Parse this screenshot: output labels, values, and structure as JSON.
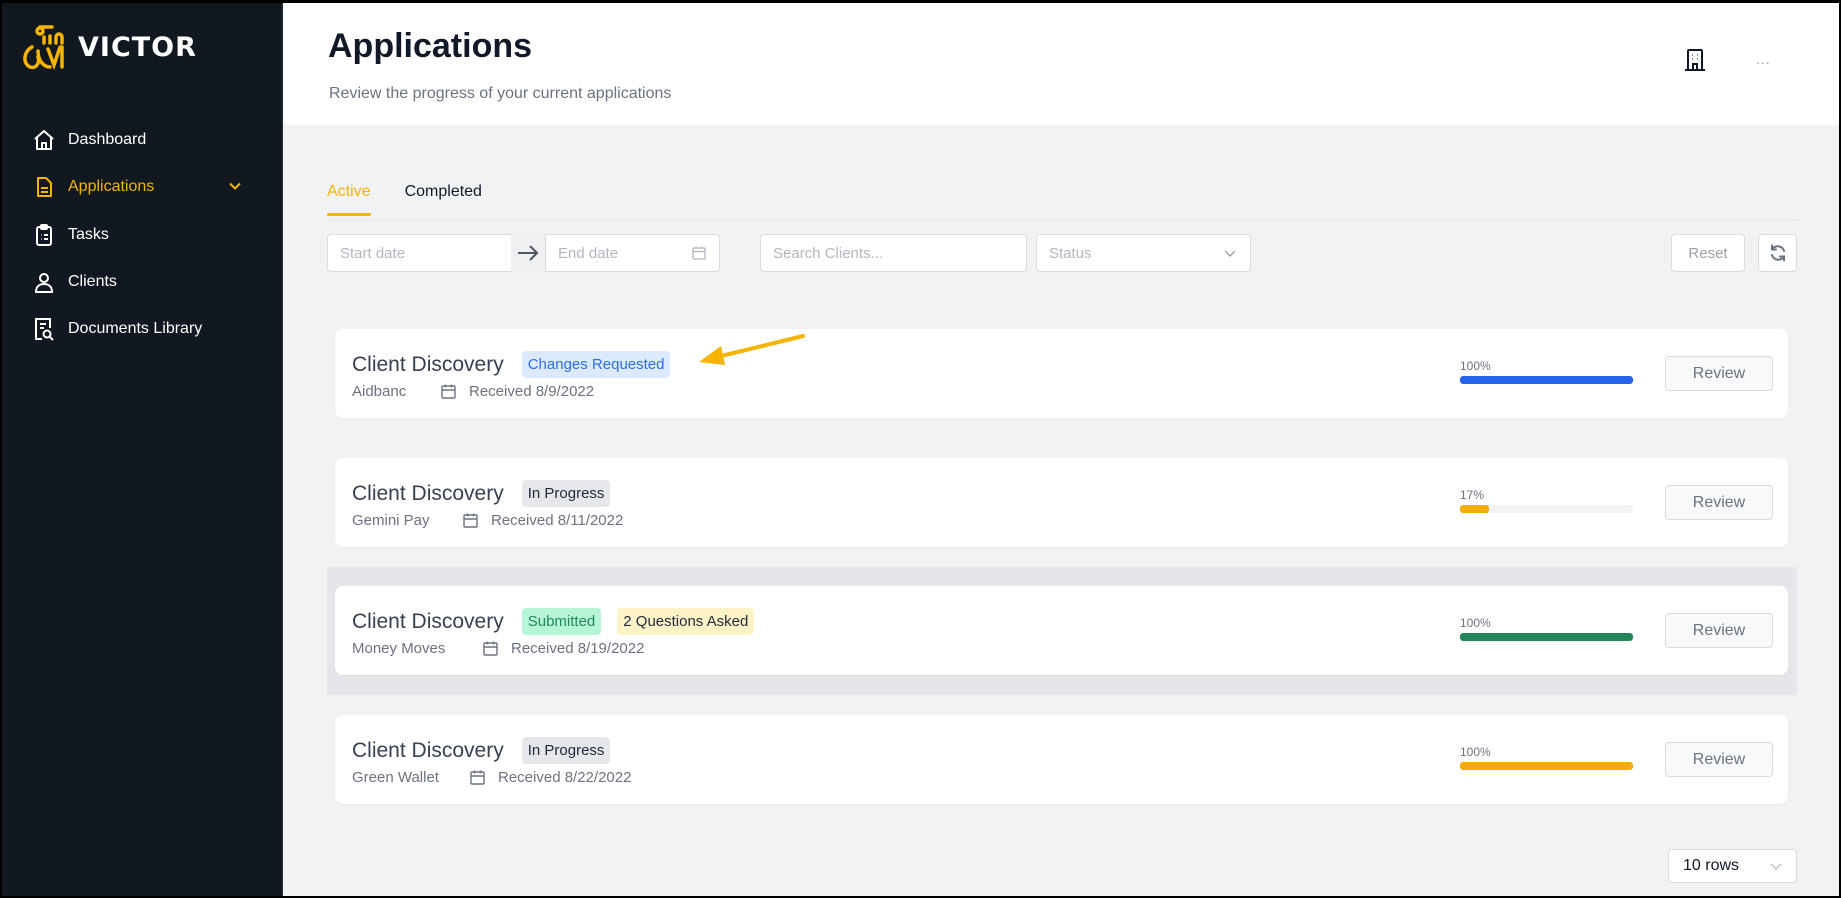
{
  "app": {
    "name": "VICTOR",
    "brand_color": "#f5b400"
  },
  "sidebar": {
    "items": [
      {
        "label": "Dashboard",
        "icon": "home-icon",
        "active": false
      },
      {
        "label": "Applications",
        "icon": "document-icon",
        "active": true,
        "expandable": true
      },
      {
        "label": "Tasks",
        "icon": "clipboard-icon",
        "active": false
      },
      {
        "label": "Clients",
        "icon": "user-icon",
        "active": false
      },
      {
        "label": "Documents Library",
        "icon": "document-search-icon",
        "active": false
      }
    ]
  },
  "header": {
    "title": "Applications",
    "subtitle": "Review the progress of your current applications",
    "more_label": "..."
  },
  "tabs": [
    {
      "label": "Active",
      "active": true
    },
    {
      "label": "Completed",
      "active": false
    }
  ],
  "filters": {
    "start_date_placeholder": "Start date",
    "end_date_placeholder": "End date",
    "search_placeholder": "Search Clients...",
    "status_placeholder": "Status",
    "reset_label": "Reset"
  },
  "applications": [
    {
      "title": "Client Discovery",
      "badges": [
        {
          "label": "Changes Requested",
          "color": "blue"
        }
      ],
      "client": "Aidbanc",
      "received": "Received 8/9/2022",
      "progress_label": "100%",
      "progress": 100,
      "progress_color": "#2563eb",
      "action": "Review"
    },
    {
      "title": "Client Discovery",
      "badges": [
        {
          "label": "In Progress",
          "color": "gray"
        }
      ],
      "client": "Gemini Pay",
      "received": "Received 8/11/2022",
      "progress_label": "17%",
      "progress": 17,
      "progress_color": "#f5ac00",
      "action": "Review"
    },
    {
      "title": "Client Discovery",
      "badges": [
        {
          "label": "Submitted",
          "color": "green"
        },
        {
          "label": "2 Questions Asked",
          "color": "yellow"
        }
      ],
      "client": "Money Moves",
      "received": "Received 8/19/2022",
      "progress_label": "100%",
      "progress": 100,
      "progress_color": "#23865a",
      "action": "Review",
      "highlighted": true
    },
    {
      "title": "Client Discovery",
      "badges": [
        {
          "label": "In Progress",
          "color": "gray"
        }
      ],
      "client": "Green Wallet",
      "received": "Received 8/22/2022",
      "progress_label": "100%",
      "progress": 100,
      "progress_color": "#f5ac00",
      "action": "Review"
    }
  ],
  "pagination": {
    "rows_label": "10 rows"
  }
}
